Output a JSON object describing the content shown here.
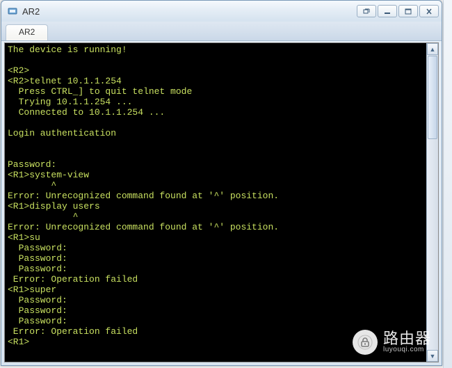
{
  "window": {
    "title": "AR2"
  },
  "tabs": [
    {
      "label": "AR2"
    }
  ],
  "terminal": {
    "lines": [
      "The device is running!",
      "",
      "<R2>",
      "<R2>telnet 10.1.1.254",
      "  Press CTRL_] to quit telnet mode",
      "  Trying 10.1.1.254 ...",
      "  Connected to 10.1.1.254 ...",
      "",
      "Login authentication",
      "",
      "",
      "Password:",
      "<R1>system-view",
      "        ^",
      "Error: Unrecognized command found at '^' position.",
      "<R1>display users",
      "            ^",
      "Error: Unrecognized command found at '^' position.",
      "<R1>su",
      "  Password:",
      "  Password:",
      "  Password:",
      " Error: Operation failed",
      "<R1>super",
      "  Password:",
      "  Password:",
      "  Password:",
      " Error: Operation failed",
      "<R1>"
    ]
  },
  "watermark": {
    "brand": "路由器",
    "url": "luyouqi.com"
  }
}
